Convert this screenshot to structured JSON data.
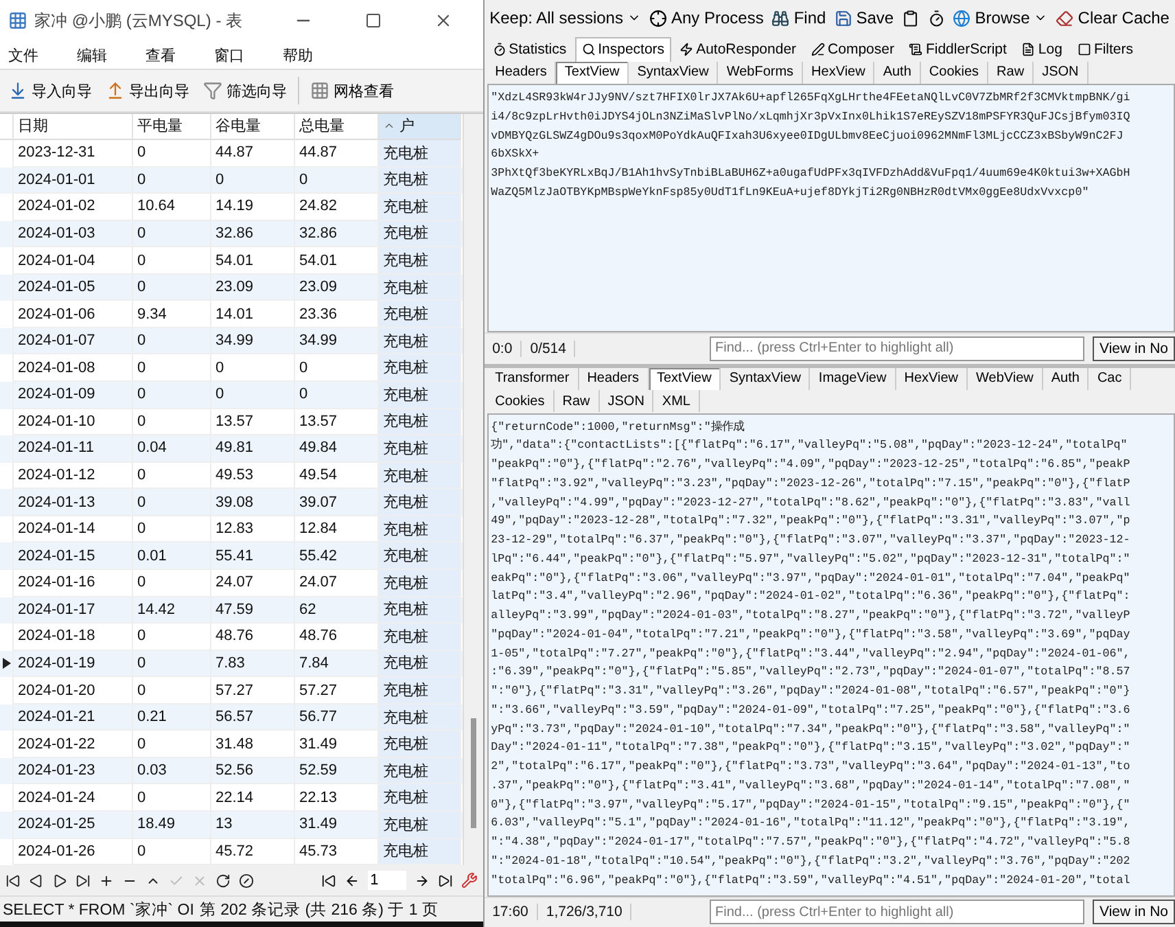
{
  "navicat": {
    "window": {
      "title": "家冲 @小鹏 (云MYSQL) - 表"
    },
    "menu": [
      "文件",
      "编辑",
      "查看",
      "窗口",
      "帮助"
    ],
    "toolbar": [
      {
        "kind": "import",
        "label": "导入向导"
      },
      {
        "kind": "export",
        "label": "导出向导"
      },
      {
        "kind": "filter",
        "label": "筛选向导"
      },
      {
        "kind": "grid",
        "label": "网格查看"
      }
    ],
    "table": {
      "columns": [
        {
          "label": "日期",
          "sorted": false
        },
        {
          "label": "平电量",
          "sorted": false
        },
        {
          "label": "谷电量",
          "sorted": false
        },
        {
          "label": "总电量",
          "sorted": false
        },
        {
          "label": "户",
          "sorted": true
        }
      ],
      "rows": [
        {
          "cells": [
            "2023-12-31",
            "0",
            "44.87",
            "44.87",
            "充电桩"
          ],
          "current": false
        },
        {
          "cells": [
            "2024-01-01",
            "0",
            "0",
            "0",
            "充电桩"
          ],
          "current": false
        },
        {
          "cells": [
            "2024-01-02",
            "10.64",
            "14.19",
            "24.82",
            "充电桩"
          ],
          "current": false
        },
        {
          "cells": [
            "2024-01-03",
            "0",
            "32.86",
            "32.86",
            "充电桩"
          ],
          "current": false
        },
        {
          "cells": [
            "2024-01-04",
            "0",
            "54.01",
            "54.01",
            "充电桩"
          ],
          "current": false
        },
        {
          "cells": [
            "2024-01-05",
            "0",
            "23.09",
            "23.09",
            "充电桩"
          ],
          "current": false
        },
        {
          "cells": [
            "2024-01-06",
            "9.34",
            "14.01",
            "23.36",
            "充电桩"
          ],
          "current": false
        },
        {
          "cells": [
            "2024-01-07",
            "0",
            "34.99",
            "34.99",
            "充电桩"
          ],
          "current": false
        },
        {
          "cells": [
            "2024-01-08",
            "0",
            "0",
            "0",
            "充电桩"
          ],
          "current": false
        },
        {
          "cells": [
            "2024-01-09",
            "0",
            "0",
            "0",
            "充电桩"
          ],
          "current": false
        },
        {
          "cells": [
            "2024-01-10",
            "0",
            "13.57",
            "13.57",
            "充电桩"
          ],
          "current": false
        },
        {
          "cells": [
            "2024-01-11",
            "0.04",
            "49.81",
            "49.84",
            "充电桩"
          ],
          "current": false
        },
        {
          "cells": [
            "2024-01-12",
            "0",
            "49.53",
            "49.54",
            "充电桩"
          ],
          "current": false
        },
        {
          "cells": [
            "2024-01-13",
            "0",
            "39.08",
            "39.07",
            "充电桩"
          ],
          "current": false
        },
        {
          "cells": [
            "2024-01-14",
            "0",
            "12.83",
            "12.84",
            "充电桩"
          ],
          "current": false
        },
        {
          "cells": [
            "2024-01-15",
            "0.01",
            "55.41",
            "55.42",
            "充电桩"
          ],
          "current": false
        },
        {
          "cells": [
            "2024-01-16",
            "0",
            "24.07",
            "24.07",
            "充电桩"
          ],
          "current": false
        },
        {
          "cells": [
            "2024-01-17",
            "14.42",
            "47.59",
            "62",
            "充电桩"
          ],
          "current": false
        },
        {
          "cells": [
            "2024-01-18",
            "0",
            "48.76",
            "48.76",
            "充电桩"
          ],
          "current": false
        },
        {
          "cells": [
            "2024-01-19",
            "0",
            "7.83",
            "7.84",
            "充电桩"
          ],
          "current": true
        },
        {
          "cells": [
            "2024-01-20",
            "0",
            "57.27",
            "57.27",
            "充电桩"
          ],
          "current": false
        },
        {
          "cells": [
            "2024-01-21",
            "0.21",
            "56.57",
            "56.77",
            "充电桩"
          ],
          "current": false
        },
        {
          "cells": [
            "2024-01-22",
            "0",
            "31.48",
            "31.49",
            "充电桩"
          ],
          "current": false
        },
        {
          "cells": [
            "2024-01-23",
            "0.03",
            "52.56",
            "52.59",
            "充电桩"
          ],
          "current": false
        },
        {
          "cells": [
            "2024-01-24",
            "0",
            "22.14",
            "22.13",
            "充电桩"
          ],
          "current": false
        },
        {
          "cells": [
            "2024-01-25",
            "18.49",
            "13",
            "31.49",
            "充电桩"
          ],
          "current": false
        },
        {
          "cells": [
            "2024-01-26",
            "0",
            "45.72",
            "45.73",
            "充电桩"
          ],
          "current": false
        }
      ]
    },
    "page_number": "1",
    "status": [
      "SELECT * FROM `家冲` OI",
      "第 202 条记录 (共 216 条) 于 1 页"
    ]
  },
  "fiddler": {
    "toolbar": [
      {
        "kind": "keep",
        "label": "Keep: All sessions"
      },
      {
        "kind": "process",
        "label": "Any Process"
      },
      {
        "kind": "find",
        "label": "Find"
      },
      {
        "kind": "save",
        "label": "Save"
      },
      {
        "kind": "browse",
        "label": "Browse"
      },
      {
        "kind": "cache",
        "label": "Clear Cache"
      }
    ],
    "main_tabs": [
      {
        "label": "Statistics",
        "selected": false
      },
      {
        "label": "Inspectors",
        "selected": true
      },
      {
        "label": "AutoResponder",
        "selected": false
      },
      {
        "label": "Composer",
        "selected": false
      },
      {
        "label": "FiddlerScript",
        "selected": false
      },
      {
        "label": "Log",
        "selected": false
      },
      {
        "label": "Filters",
        "selected": false
      }
    ],
    "request_tabs": [
      {
        "label": "Headers",
        "selected": false
      },
      {
        "label": "TextView",
        "selected": true
      },
      {
        "label": "SyntaxView",
        "selected": false
      },
      {
        "label": "WebForms",
        "selected": false
      },
      {
        "label": "HexView",
        "selected": false
      },
      {
        "label": "Auth",
        "selected": false
      },
      {
        "label": "Cookies",
        "selected": false
      },
      {
        "label": "Raw",
        "selected": false
      },
      {
        "label": "JSON",
        "selected": false
      }
    ],
    "request_body": [
      "\"XdzL4SR93kW4rJJy9NV/szt7HFIX0lrJX7Ak6U+apfl265FqXgLHrthe4FEetaNQlLvC0V7ZbMRf2f3CMVktmpBNK/gi",
      "i4/8c9zpLrHvth0iJDYS4jOLn3NZiMaSlvPlNo/xLqmhjXr3pVxInx0Lhik1S7eREySZV18mPSFYR3QuFJCsjBfym03IQ",
      "vDMBYQzGLSWZ4gDOu9s3qoxM0PoYdkAuQFIxah3U6xyee0IDgULbmv8EeCjuoi0962MNmFl3MLjcCCZ3xBSbyW9nC2FJ",
      "6bXSkX+",
      "3PhXtQf3beKYRLxBqJ/B1Ah1hvSyTnbiBLaBUH6Z+a0ugafUdPFx3qIVFDzhAdd&VuFpq1/4uum69e4K0ktui3w+XAGbH",
      "WaZQ5MlzJaOTBYKpMBspWeYknFsp85y0UdT1fLn9KEuA+ujef8DYkjTi2Rg0NBHzR0dtVMx0ggEe8UdxVvxcp0\""
    ],
    "request_status": {
      "position": "0:0",
      "count": "0/514",
      "find_placeholder": "Find... (press Ctrl+Enter to highlight all)",
      "button": "View in No"
    },
    "response_tabs": [
      {
        "label": "Transformer",
        "selected": false
      },
      {
        "label": "Headers",
        "selected": false
      },
      {
        "label": "TextView",
        "selected": true
      },
      {
        "label": "SyntaxView",
        "selected": false
      },
      {
        "label": "ImageView",
        "selected": false
      },
      {
        "label": "HexView",
        "selected": false
      },
      {
        "label": "WebView",
        "selected": false
      },
      {
        "label": "Auth",
        "selected": false
      },
      {
        "label": "Cac",
        "selected": false
      }
    ],
    "response_tabs_2": [
      {
        "label": "Cookies",
        "selected": false
      },
      {
        "label": "Raw",
        "selected": false
      },
      {
        "label": "JSON",
        "selected": false
      },
      {
        "label": "XML",
        "selected": false
      }
    ],
    "response_body": [
      "{\"returnCode\":1000,\"returnMsg\":\"操作成",
      "功\",\"data\":{\"contactLists\":[{\"flatPq\":\"6.17\",\"valleyPq\":\"5.08\",\"pqDay\":\"2023-12-24\",\"totalPq\"",
      "\"peakPq\":\"0\"},{\"flatPq\":\"2.76\",\"valleyPq\":\"4.09\",\"pqDay\":\"2023-12-25\",\"totalPq\":\"6.85\",\"peakP",
      "\"flatPq\":\"3.92\",\"valleyPq\":\"3.23\",\"pqDay\":\"2023-12-26\",\"totalPq\":\"7.15\",\"peakPq\":\"0\"},{\"flatP",
      ",\"valleyPq\":\"4.99\",\"pqDay\":\"2023-12-27\",\"totalPq\":\"8.62\",\"peakPq\":\"0\"},{\"flatPq\":\"3.83\",\"vall",
      "49\",\"pqDay\":\"2023-12-28\",\"totalPq\":\"7.32\",\"peakPq\":\"0\"},{\"flatPq\":\"3.31\",\"valleyPq\":\"3.07\",\"p",
      "23-12-29\",\"totalPq\":\"6.37\",\"peakPq\":\"0\"},{\"flatPq\":\"3.07\",\"valleyPq\":\"3.37\",\"pqDay\":\"2023-12-",
      "lPq\":\"6.44\",\"peakPq\":\"0\"},{\"flatPq\":\"5.97\",\"valleyPq\":\"5.02\",\"pqDay\":\"2023-12-31\",\"totalPq\":\"",
      "eakPq\":\"0\"},{\"flatPq\":\"3.06\",\"valleyPq\":\"3.97\",\"pqDay\":\"2024-01-01\",\"totalPq\":\"7.04\",\"peakPq\"",
      "latPq\":\"3.4\",\"valleyPq\":\"2.96\",\"pqDay\":\"2024-01-02\",\"totalPq\":\"6.36\",\"peakPq\":\"0\"},{\"flatPq\":",
      "alleyPq\":\"3.99\",\"pqDay\":\"2024-01-03\",\"totalPq\":\"8.27\",\"peakPq\":\"0\"},{\"flatPq\":\"3.72\",\"valleyP",
      "\"pqDay\":\"2024-01-04\",\"totalPq\":\"7.21\",\"peakPq\":\"0\"},{\"flatPq\":\"3.58\",\"valleyPq\":\"3.69\",\"pqDay",
      "1-05\",\"totalPq\":\"7.27\",\"peakPq\":\"0\"},{\"flatPq\":\"3.44\",\"valleyPq\":\"2.94\",\"pqDay\":\"2024-01-06\",",
      ":\"6.39\",\"peakPq\":\"0\"},{\"flatPq\":\"5.85\",\"valleyPq\":\"2.73\",\"pqDay\":\"2024-01-07\",\"totalPq\":\"8.57",
      "\":\"0\"},{\"flatPq\":\"3.31\",\"valleyPq\":\"3.26\",\"pqDay\":\"2024-01-08\",\"totalPq\":\"6.57\",\"peakPq\":\"0\"}",
      "\":\"3.66\",\"valleyPq\":\"3.59\",\"pqDay\":\"2024-01-09\",\"totalPq\":\"7.25\",\"peakPq\":\"0\"},{\"flatPq\":\"3.6",
      "yPq\":\"3.73\",\"pqDay\":\"2024-01-10\",\"totalPq\":\"7.34\",\"peakPq\":\"0\"},{\"flatPq\":\"3.58\",\"valleyPq\":\"",
      "Day\":\"2024-01-11\",\"totalPq\":\"7.38\",\"peakPq\":\"0\"},{\"flatPq\":\"3.15\",\"valleyPq\":\"3.02\",\"pqDay\":\"",
      "2\",\"totalPq\":\"6.17\",\"peakPq\":\"0\"},{\"flatPq\":\"3.73\",\"valleyPq\":\"3.64\",\"pqDay\":\"2024-01-13\",\"to",
      ".37\",\"peakPq\":\"0\"},{\"flatPq\":\"3.41\",\"valleyPq\":\"3.68\",\"pqDay\":\"2024-01-14\",\"totalPq\":\"7.08\",\"",
      "0\"},{\"flatPq\":\"3.97\",\"valleyPq\":\"5.17\",\"pqDay\":\"2024-01-15\",\"totalPq\":\"9.15\",\"peakPq\":\"0\"},{\"",
      "6.03\",\"valleyPq\":\"5.1\",\"pqDay\":\"2024-01-16\",\"totalPq\":\"11.12\",\"peakPq\":\"0\"},{\"flatPq\":\"3.19\",",
      "\":\"4.38\",\"pqDay\":\"2024-01-17\",\"totalPq\":\"7.57\",\"peakPq\":\"0\"},{\"flatPq\":\"4.72\",\"valleyPq\":\"5.8",
      "\":\"2024-01-18\",\"totalPq\":\"10.54\",\"peakPq\":\"0\"},{\"flatPq\":\"3.2\",\"valleyPq\":\"3.76\",\"pqDay\":\"202",
      "\"totalPq\":\"6.96\",\"peakPq\":\"0\"},{\"flatPq\":\"3.59\",\"valleyPq\":\"4.51\",\"pqDay\":\"2024-01-20\",\"total"
    ],
    "response_status": {
      "position": "17:60",
      "count": "1,726/3,710",
      "find_placeholder": "Find... (press Ctrl+Enter to highlight all)",
      "button": "View in No"
    }
  }
}
